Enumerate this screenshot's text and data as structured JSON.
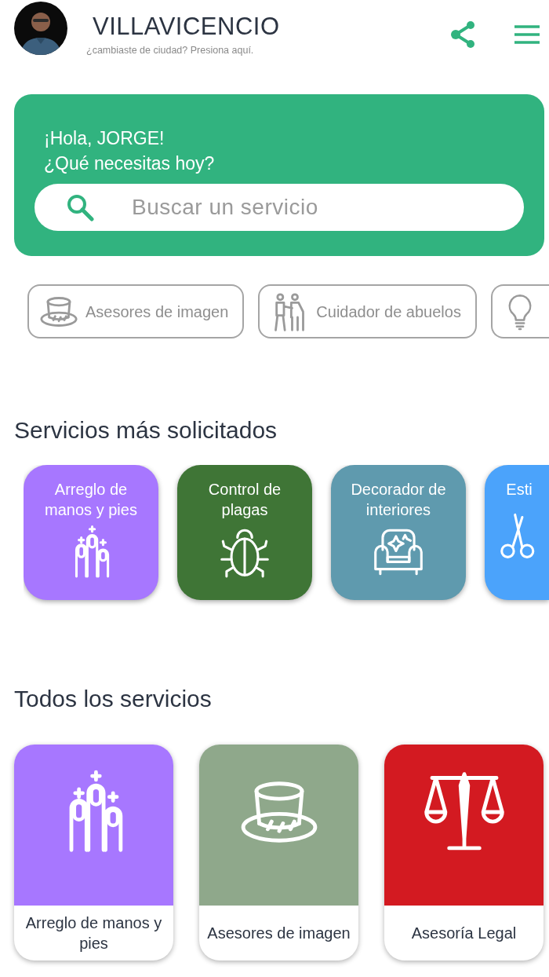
{
  "header": {
    "city": "VILLAVICENCIO",
    "hint": "¿cambiaste de ciudad? Presiona aquí."
  },
  "welcome": {
    "greeting": "¡Hola, JORGE!",
    "question": "¿Qué necesitas hoy?",
    "search": {
      "placeholder": "Buscar un servicio"
    }
  },
  "quick_chips": [
    {
      "label": "Asesores de imagen",
      "kind": "hat"
    },
    {
      "label": "Cuidador de abuelos",
      "kind": "elders"
    },
    {
      "kind": "bulb"
    }
  ],
  "popular": {
    "title": "Servicios más solicitados",
    "tiles": [
      {
        "label": "Arreglo de manos y pies",
        "kind": "nails",
        "color": "#a777ff"
      },
      {
        "label": "Control de plagas",
        "kind": "bug",
        "color": "#3f7536"
      },
      {
        "label": "Decorador de interiores",
        "kind": "sofa",
        "color": "#5f9aae"
      },
      {
        "label": "Esti",
        "kind": "scissors",
        "color": "#4ba3fb"
      }
    ]
  },
  "all": {
    "title": "Todos los servicios",
    "cards": [
      {
        "label": "Arreglo de manos y pies",
        "kind": "nails",
        "color": "#a777ff"
      },
      {
        "label": "Asesores de imagen",
        "kind": "hat",
        "color": "#8fa88b"
      },
      {
        "label": "Asesoría Legal",
        "kind": "scales",
        "color": "#d31a21"
      }
    ]
  }
}
